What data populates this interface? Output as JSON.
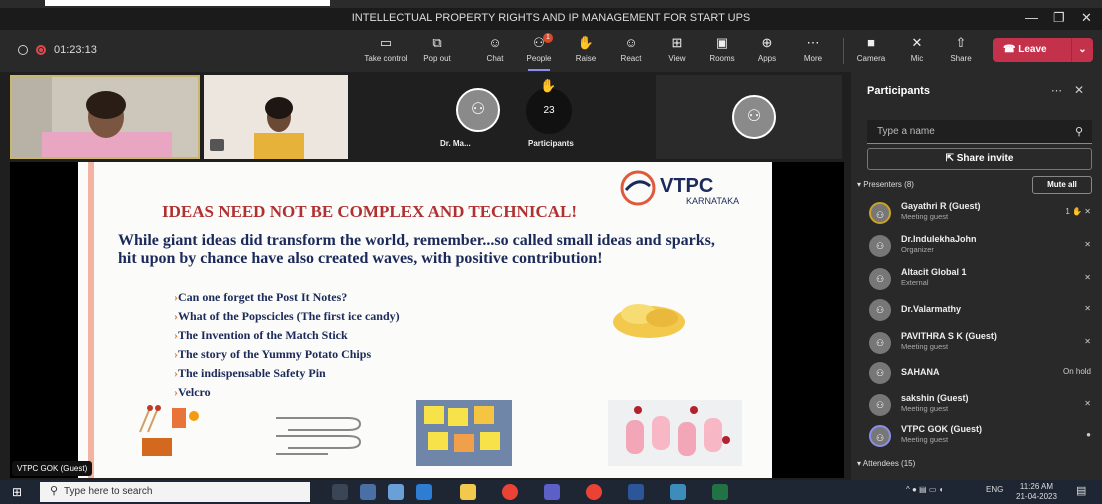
{
  "window": {
    "title": "INTELLECTUAL PROPERTY RIGHTS AND IP MANAGEMENT FOR START UPS",
    "minimize": "—",
    "maximize": "❐",
    "close": "✕"
  },
  "meeting": {
    "timer": "01:23:13"
  },
  "toolbar": {
    "take_control": "Take control",
    "pop_out": "Pop out",
    "chat": "Chat",
    "people": "People",
    "people_badge": "1",
    "raise": "Raise",
    "react": "React",
    "view": "View",
    "rooms": "Rooms",
    "apps": "Apps",
    "more": "More",
    "camera": "Camera",
    "mic": "Mic",
    "share": "Share",
    "leave": "Leave"
  },
  "stage": {
    "tile_name": "Dr. Ma...",
    "participants_count": "23",
    "participants_label": "Participants",
    "presenter_tag": "VTPC GOK (Guest)"
  },
  "slide": {
    "logo_text": "VTPC",
    "logo_sub": "KARNATAKA",
    "heading": "IDEAS NEED NOT BE COMPLEX AND TECHNICAL!",
    "body": "While giant ideas did transform the world, remember...so called small ideas and sparks, hit upon by chance have also created waves, with positive contribution!",
    "bullets": [
      "Can one forget the Post It Notes?",
      "What of the Popscicles (The first ice candy)",
      "The Invention of the Match Stick",
      "The story of the Yummy Potato Chips",
      "The indispensable Safety Pin",
      "Velcro"
    ]
  },
  "panel": {
    "title": "Participants",
    "search_placeholder": "Type a name",
    "share_invite": "Share invite",
    "presenters_header": "Presenters (8)",
    "mute_all": "Mute all",
    "presenters": [
      {
        "name": "Gayathri R (Guest)",
        "role": "Meeting guest",
        "status": "1"
      },
      {
        "name": "Dr.IndulekhaJohn",
        "role": "Organizer",
        "status": ""
      },
      {
        "name": "Altacit Global 1",
        "role": "External",
        "status": ""
      },
      {
        "name": "Dr.Valarmathy",
        "role": "",
        "status": ""
      },
      {
        "name": "PAVITHRA S K (Guest)",
        "role": "Meeting guest",
        "status": ""
      },
      {
        "name": "SAHANA",
        "role": "",
        "status": "On hold"
      },
      {
        "name": "sakshin (Guest)",
        "role": "Meeting guest",
        "status": ""
      },
      {
        "name": "VTPC GOK (Guest)",
        "role": "Meeting guest",
        "status": ""
      }
    ],
    "attendees_header": "Attendees (15)"
  },
  "taskbar": {
    "search_placeholder": "Type here to search",
    "lang": "ENG",
    "time": "11:26 AM",
    "date": "21-04-2023"
  }
}
